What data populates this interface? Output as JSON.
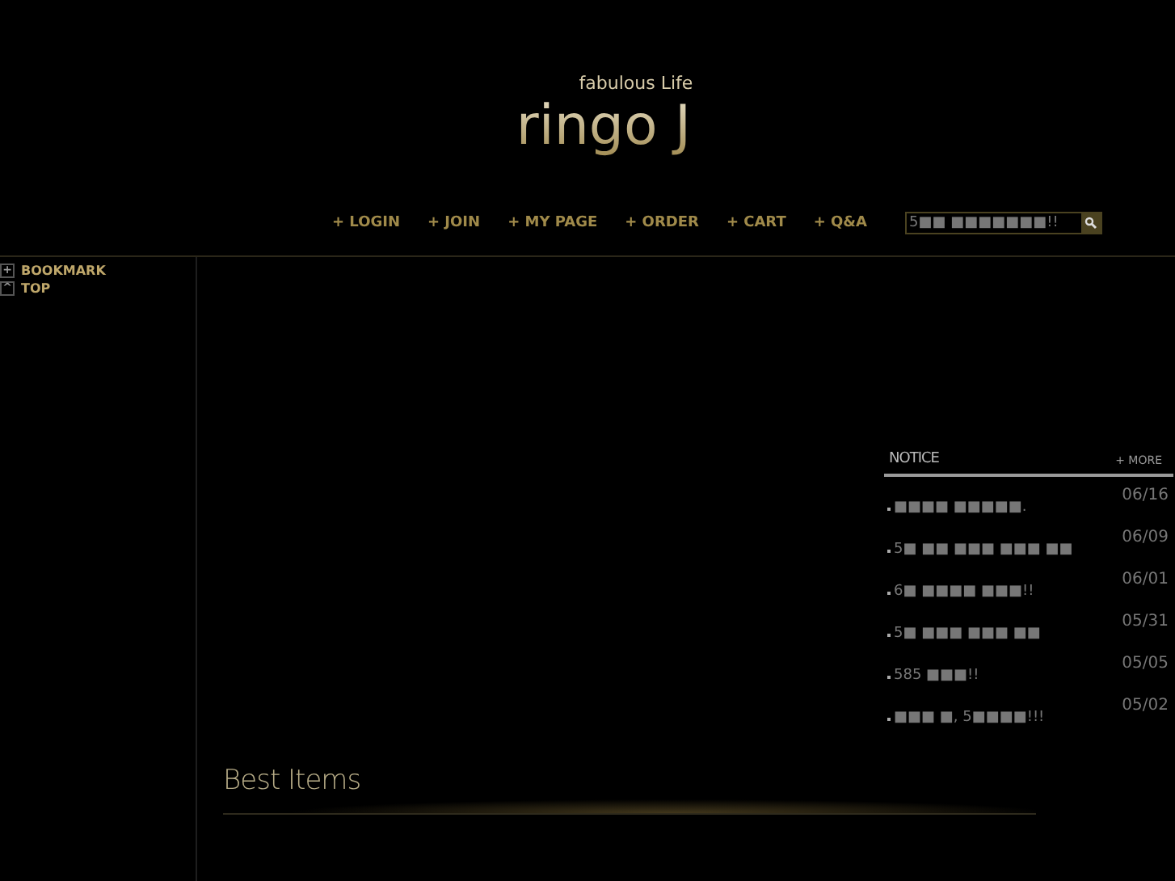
{
  "logo": {
    "tagline": "fabulous Life",
    "name": "ringo J"
  },
  "nav": [
    {
      "label": "+ LOGIN"
    },
    {
      "label": "+ JOIN"
    },
    {
      "label": "+ MY PAGE"
    },
    {
      "label": "+ ORDER"
    },
    {
      "label": "+ CART"
    },
    {
      "label": "+ Q&A"
    }
  ],
  "search": {
    "value": "5■■ ■■■■■■■!!"
  },
  "sidebar": [
    {
      "icon": "+",
      "label": "BOOKMARK"
    },
    {
      "icon": "^",
      "label": "TOP"
    }
  ],
  "notice": {
    "title": "NOTICE",
    "more": "+ MORE",
    "items": [
      {
        "text": "■■■■ ■■■■■.",
        "date": "06/16"
      },
      {
        "text": "5■ ■■ ■■■ ■■■ ■■",
        "date": "06/09"
      },
      {
        "text": "6■ ■■■■ ■■■!!",
        "date": "06/01"
      },
      {
        "text": "5■ ■■■ ■■■ ■■",
        "date": "05/31"
      },
      {
        "text": "585 ■■■!!",
        "date": "05/05"
      },
      {
        "text": "■■■ ■, 5■■■■!!!",
        "date": "05/02"
      }
    ]
  },
  "best_items": {
    "title": "Best Items"
  }
}
